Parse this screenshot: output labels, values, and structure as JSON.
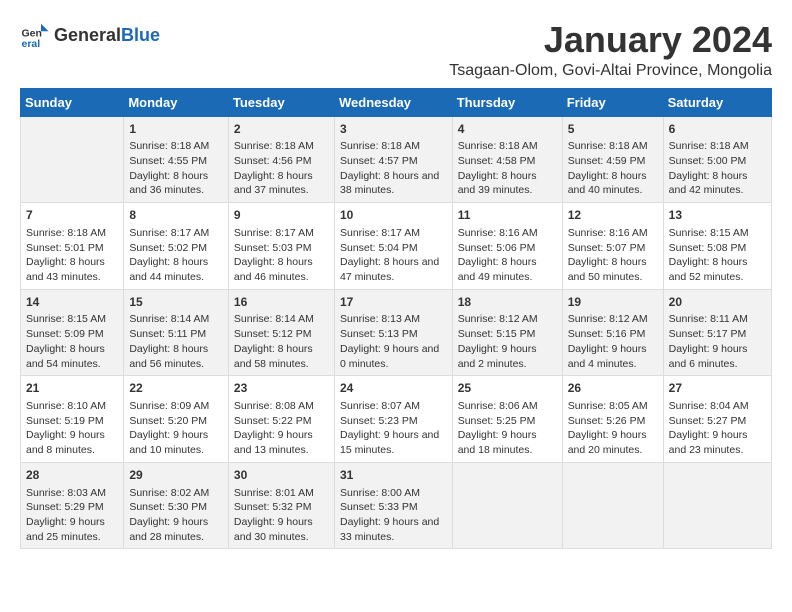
{
  "logo": {
    "general": "General",
    "blue": "Blue"
  },
  "title": "January 2024",
  "subtitle": "Tsagaan-Olom, Govi-Altai Province, Mongolia",
  "columns": [
    "Sunday",
    "Monday",
    "Tuesday",
    "Wednesday",
    "Thursday",
    "Friday",
    "Saturday"
  ],
  "weeks": [
    [
      {
        "day": "",
        "sunrise": "",
        "sunset": "",
        "daylight": ""
      },
      {
        "day": "1",
        "sunrise": "Sunrise: 8:18 AM",
        "sunset": "Sunset: 4:55 PM",
        "daylight": "Daylight: 8 hours and 36 minutes."
      },
      {
        "day": "2",
        "sunrise": "Sunrise: 8:18 AM",
        "sunset": "Sunset: 4:56 PM",
        "daylight": "Daylight: 8 hours and 37 minutes."
      },
      {
        "day": "3",
        "sunrise": "Sunrise: 8:18 AM",
        "sunset": "Sunset: 4:57 PM",
        "daylight": "Daylight: 8 hours and 38 minutes."
      },
      {
        "day": "4",
        "sunrise": "Sunrise: 8:18 AM",
        "sunset": "Sunset: 4:58 PM",
        "daylight": "Daylight: 8 hours and 39 minutes."
      },
      {
        "day": "5",
        "sunrise": "Sunrise: 8:18 AM",
        "sunset": "Sunset: 4:59 PM",
        "daylight": "Daylight: 8 hours and 40 minutes."
      },
      {
        "day": "6",
        "sunrise": "Sunrise: 8:18 AM",
        "sunset": "Sunset: 5:00 PM",
        "daylight": "Daylight: 8 hours and 42 minutes."
      }
    ],
    [
      {
        "day": "7",
        "sunrise": "Sunrise: 8:18 AM",
        "sunset": "Sunset: 5:01 PM",
        "daylight": "Daylight: 8 hours and 43 minutes."
      },
      {
        "day": "8",
        "sunrise": "Sunrise: 8:17 AM",
        "sunset": "Sunset: 5:02 PM",
        "daylight": "Daylight: 8 hours and 44 minutes."
      },
      {
        "day": "9",
        "sunrise": "Sunrise: 8:17 AM",
        "sunset": "Sunset: 5:03 PM",
        "daylight": "Daylight: 8 hours and 46 minutes."
      },
      {
        "day": "10",
        "sunrise": "Sunrise: 8:17 AM",
        "sunset": "Sunset: 5:04 PM",
        "daylight": "Daylight: 8 hours and 47 minutes."
      },
      {
        "day": "11",
        "sunrise": "Sunrise: 8:16 AM",
        "sunset": "Sunset: 5:06 PM",
        "daylight": "Daylight: 8 hours and 49 minutes."
      },
      {
        "day": "12",
        "sunrise": "Sunrise: 8:16 AM",
        "sunset": "Sunset: 5:07 PM",
        "daylight": "Daylight: 8 hours and 50 minutes."
      },
      {
        "day": "13",
        "sunrise": "Sunrise: 8:15 AM",
        "sunset": "Sunset: 5:08 PM",
        "daylight": "Daylight: 8 hours and 52 minutes."
      }
    ],
    [
      {
        "day": "14",
        "sunrise": "Sunrise: 8:15 AM",
        "sunset": "Sunset: 5:09 PM",
        "daylight": "Daylight: 8 hours and 54 minutes."
      },
      {
        "day": "15",
        "sunrise": "Sunrise: 8:14 AM",
        "sunset": "Sunset: 5:11 PM",
        "daylight": "Daylight: 8 hours and 56 minutes."
      },
      {
        "day": "16",
        "sunrise": "Sunrise: 8:14 AM",
        "sunset": "Sunset: 5:12 PM",
        "daylight": "Daylight: 8 hours and 58 minutes."
      },
      {
        "day": "17",
        "sunrise": "Sunrise: 8:13 AM",
        "sunset": "Sunset: 5:13 PM",
        "daylight": "Daylight: 9 hours and 0 minutes."
      },
      {
        "day": "18",
        "sunrise": "Sunrise: 8:12 AM",
        "sunset": "Sunset: 5:15 PM",
        "daylight": "Daylight: 9 hours and 2 minutes."
      },
      {
        "day": "19",
        "sunrise": "Sunrise: 8:12 AM",
        "sunset": "Sunset: 5:16 PM",
        "daylight": "Daylight: 9 hours and 4 minutes."
      },
      {
        "day": "20",
        "sunrise": "Sunrise: 8:11 AM",
        "sunset": "Sunset: 5:17 PM",
        "daylight": "Daylight: 9 hours and 6 minutes."
      }
    ],
    [
      {
        "day": "21",
        "sunrise": "Sunrise: 8:10 AM",
        "sunset": "Sunset: 5:19 PM",
        "daylight": "Daylight: 9 hours and 8 minutes."
      },
      {
        "day": "22",
        "sunrise": "Sunrise: 8:09 AM",
        "sunset": "Sunset: 5:20 PM",
        "daylight": "Daylight: 9 hours and 10 minutes."
      },
      {
        "day": "23",
        "sunrise": "Sunrise: 8:08 AM",
        "sunset": "Sunset: 5:22 PM",
        "daylight": "Daylight: 9 hours and 13 minutes."
      },
      {
        "day": "24",
        "sunrise": "Sunrise: 8:07 AM",
        "sunset": "Sunset: 5:23 PM",
        "daylight": "Daylight: 9 hours and 15 minutes."
      },
      {
        "day": "25",
        "sunrise": "Sunrise: 8:06 AM",
        "sunset": "Sunset: 5:25 PM",
        "daylight": "Daylight: 9 hours and 18 minutes."
      },
      {
        "day": "26",
        "sunrise": "Sunrise: 8:05 AM",
        "sunset": "Sunset: 5:26 PM",
        "daylight": "Daylight: 9 hours and 20 minutes."
      },
      {
        "day": "27",
        "sunrise": "Sunrise: 8:04 AM",
        "sunset": "Sunset: 5:27 PM",
        "daylight": "Daylight: 9 hours and 23 minutes."
      }
    ],
    [
      {
        "day": "28",
        "sunrise": "Sunrise: 8:03 AM",
        "sunset": "Sunset: 5:29 PM",
        "daylight": "Daylight: 9 hours and 25 minutes."
      },
      {
        "day": "29",
        "sunrise": "Sunrise: 8:02 AM",
        "sunset": "Sunset: 5:30 PM",
        "daylight": "Daylight: 9 hours and 28 minutes."
      },
      {
        "day": "30",
        "sunrise": "Sunrise: 8:01 AM",
        "sunset": "Sunset: 5:32 PM",
        "daylight": "Daylight: 9 hours and 30 minutes."
      },
      {
        "day": "31",
        "sunrise": "Sunrise: 8:00 AM",
        "sunset": "Sunset: 5:33 PM",
        "daylight": "Daylight: 9 hours and 33 minutes."
      },
      {
        "day": "",
        "sunrise": "",
        "sunset": "",
        "daylight": ""
      },
      {
        "day": "",
        "sunrise": "",
        "sunset": "",
        "daylight": ""
      },
      {
        "day": "",
        "sunrise": "",
        "sunset": "",
        "daylight": ""
      }
    ]
  ]
}
